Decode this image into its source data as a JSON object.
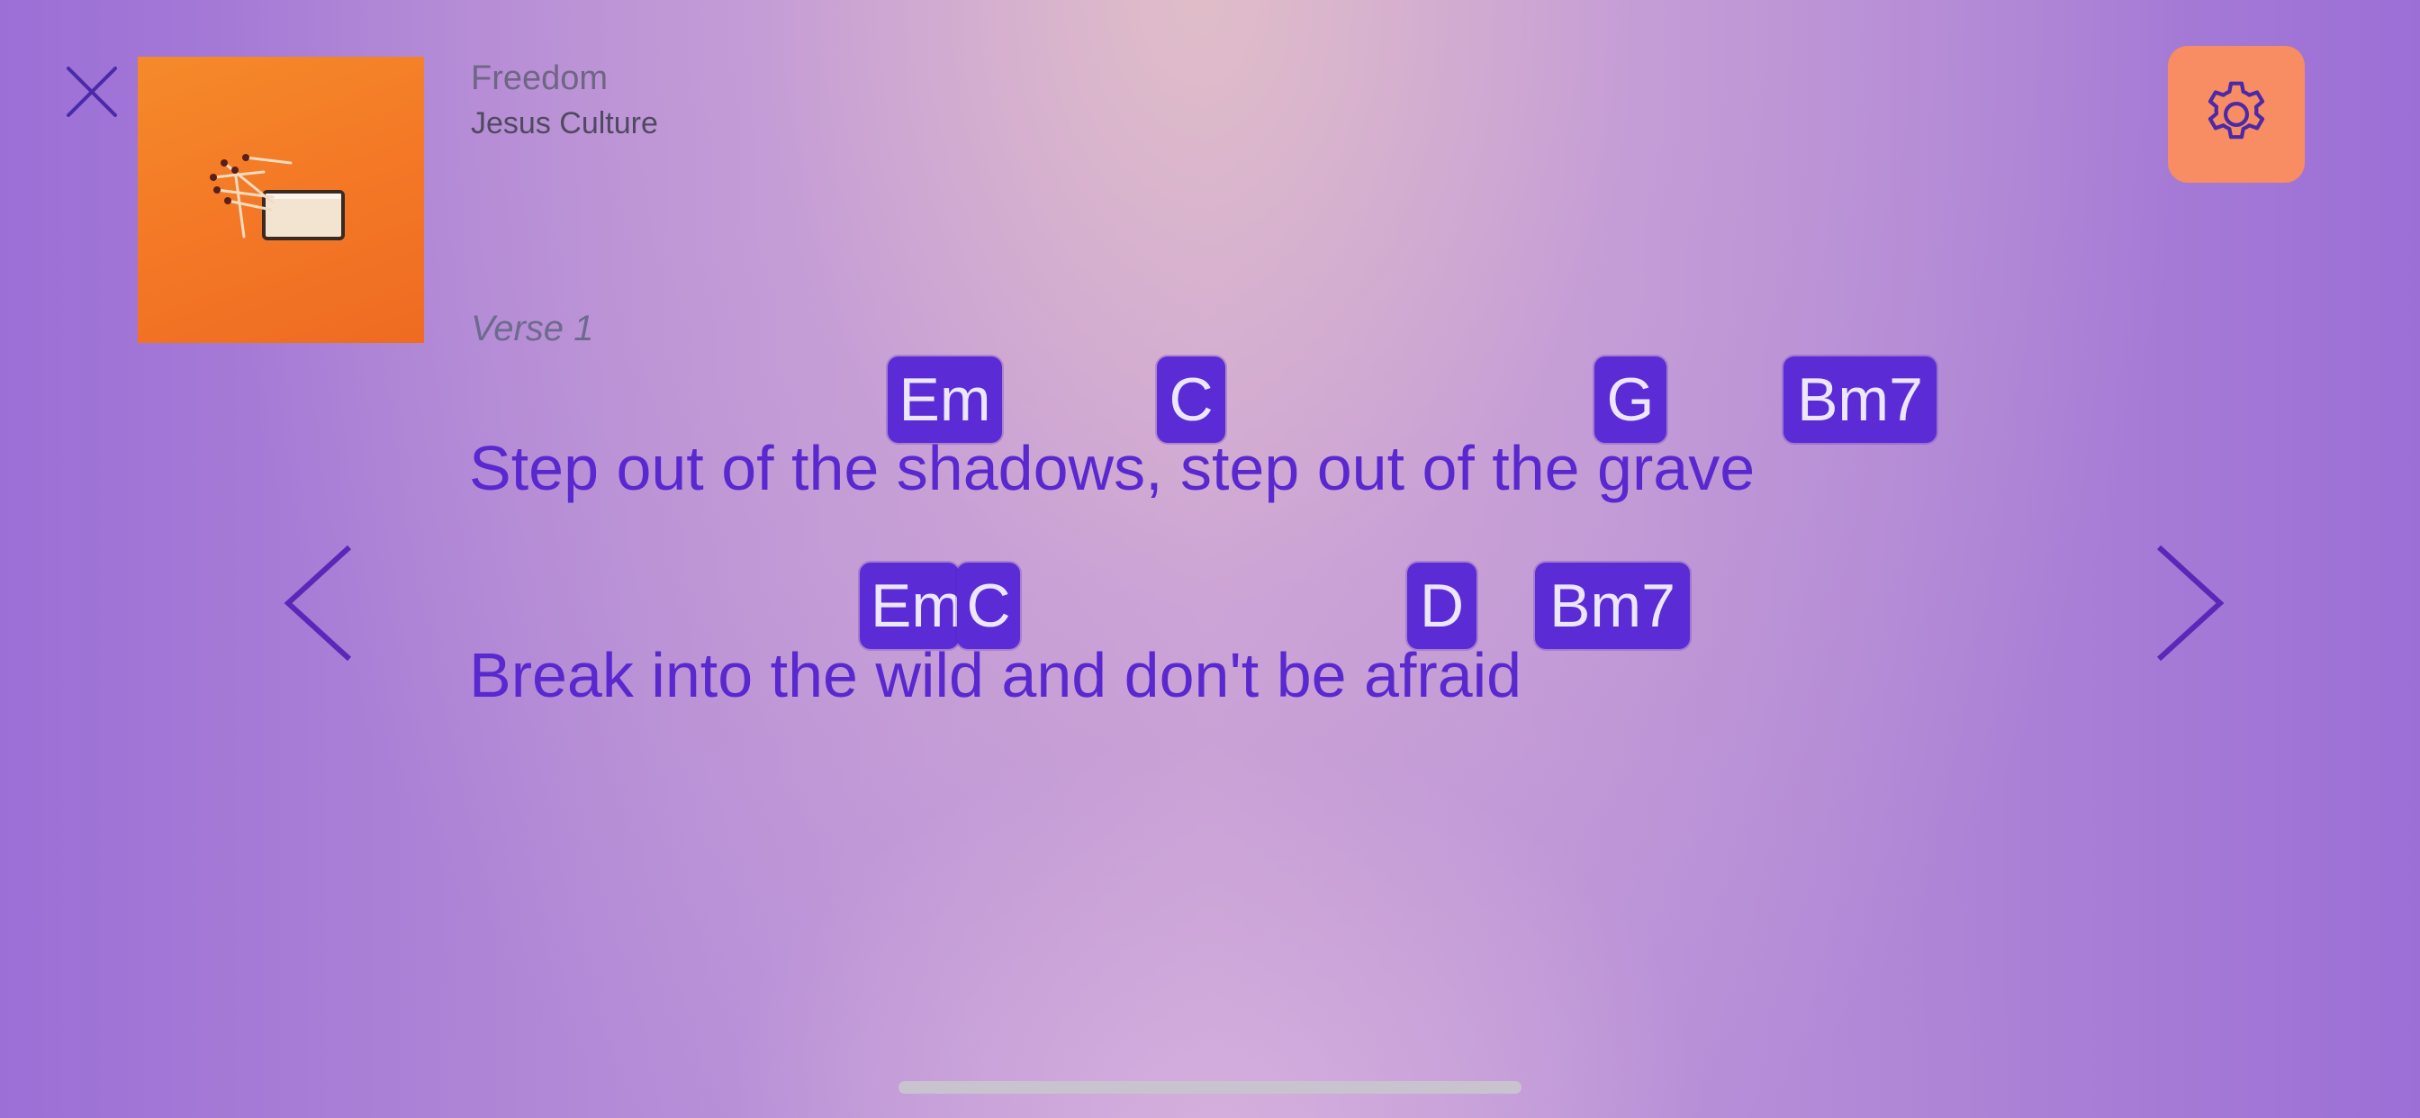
{
  "song": {
    "title": "Freedom",
    "artist": "Jesus Culture"
  },
  "section": {
    "label": "Verse 1"
  },
  "lines": [
    {
      "lyric": "Step out of the shadows, step out of the grave",
      "chords": [
        "Em",
        "C",
        "G",
        "Bm7"
      ]
    },
    {
      "lyric": "Break into the wild and don't be afraid",
      "chords": [
        "Em",
        "C",
        "D",
        "Bm7"
      ]
    }
  ],
  "icons": {
    "close": "close-icon",
    "settings": "gear-icon",
    "previous": "chevron-left-icon",
    "next": "chevron-right-icon"
  },
  "colors": {
    "chord_bg": "#5b2bd6",
    "chord_text": "#ece6ff",
    "lyric_text": "#5a28cf",
    "settings_bg": "#f88c62",
    "album_art_bg": "#f47826"
  }
}
